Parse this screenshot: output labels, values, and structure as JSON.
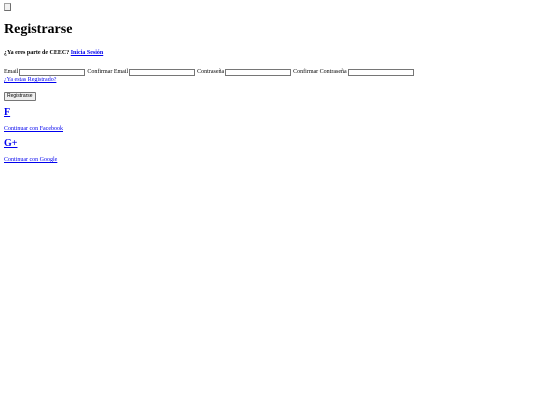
{
  "page": {
    "title": "Registrarse",
    "already_member_text": "¿Ya eres parte de CEEC?",
    "login_link": "Inicia Sesión"
  },
  "form": {
    "email_label": "Email",
    "confirm_email_label": "Confirmar Email",
    "password_label": "Contraseña",
    "confirm_password_label": "Confirmar Contraseña",
    "email_value": "",
    "confirm_email_value": "",
    "password_value": "",
    "confirm_password_value": "",
    "already_registered_link": "¿Ya estas Registrado?",
    "submit_label": "Registrarse"
  },
  "social": {
    "facebook_icon": "F",
    "facebook_label": "Continuar con Facebook",
    "google_icon": "G+",
    "google_label": "Continuar con Google"
  },
  "colors": {
    "link": "#0000ee",
    "text": "#000000",
    "background": "#ffffff"
  }
}
